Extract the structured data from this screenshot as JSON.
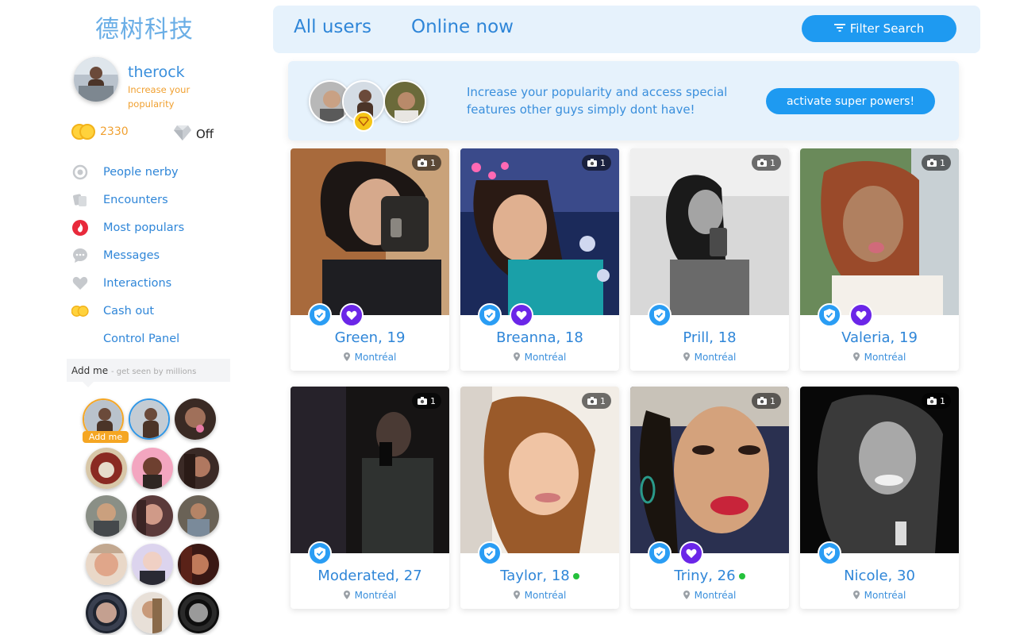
{
  "brand": {
    "title": "德树科技"
  },
  "profile": {
    "username": "therock",
    "tagline": "Increase your popularity",
    "coins": "2330",
    "premium_status": "Off"
  },
  "nav": {
    "items": [
      {
        "label": "People nerby",
        "icon": "target-icon"
      },
      {
        "label": "Encounters",
        "icon": "cards-icon"
      },
      {
        "label": "Most populars",
        "icon": "fire-icon"
      },
      {
        "label": "Messages",
        "icon": "chat-bubble-icon"
      },
      {
        "label": "Interactions",
        "icon": "heart-icon"
      },
      {
        "label": "Cash out",
        "icon": "coins-icon"
      },
      {
        "label": "Control Panel",
        "icon": ""
      }
    ]
  },
  "addme": {
    "label": "Add me",
    "hint": "- get seen by millions",
    "tag": "Add me"
  },
  "topbar": {
    "tab_all": "All users",
    "tab_online": "Online now",
    "filter_label": "Filter Search"
  },
  "promo": {
    "text": "Increase your popularity and access special features other guys simply dont have!",
    "button": "activate super powers!"
  },
  "cards": [
    {
      "name": "Green, 19",
      "location": "Montréal",
      "photos": "1",
      "verified": true,
      "favorite": true,
      "online": false
    },
    {
      "name": "Breanna, 18",
      "location": "Montréal",
      "photos": "1",
      "verified": true,
      "favorite": true,
      "online": false
    },
    {
      "name": "Prill, 18",
      "location": "Montréal",
      "photos": "1",
      "verified": true,
      "favorite": false,
      "online": false
    },
    {
      "name": "Valeria, 19",
      "location": "Montréal",
      "photos": "1",
      "verified": true,
      "favorite": true,
      "online": false
    },
    {
      "name": "Moderated, 27",
      "location": "Montréal",
      "photos": "1",
      "verified": true,
      "favorite": false,
      "online": false
    },
    {
      "name": "Taylor, 18",
      "location": "Montréal",
      "photos": "1",
      "verified": true,
      "favorite": false,
      "online": true
    },
    {
      "name": "Triny, 26",
      "location": "Montréal",
      "photos": "1",
      "verified": true,
      "favorite": true,
      "online": true
    },
    {
      "name": "Nicole, 30",
      "location": "Montréal",
      "photos": "1",
      "verified": true,
      "favorite": false,
      "online": false
    }
  ],
  "colors": {
    "accent": "#1e9af1",
    "link": "#2f86d8",
    "orange": "#f5a623",
    "fav": "#6b26e8",
    "online": "#25c13c"
  }
}
